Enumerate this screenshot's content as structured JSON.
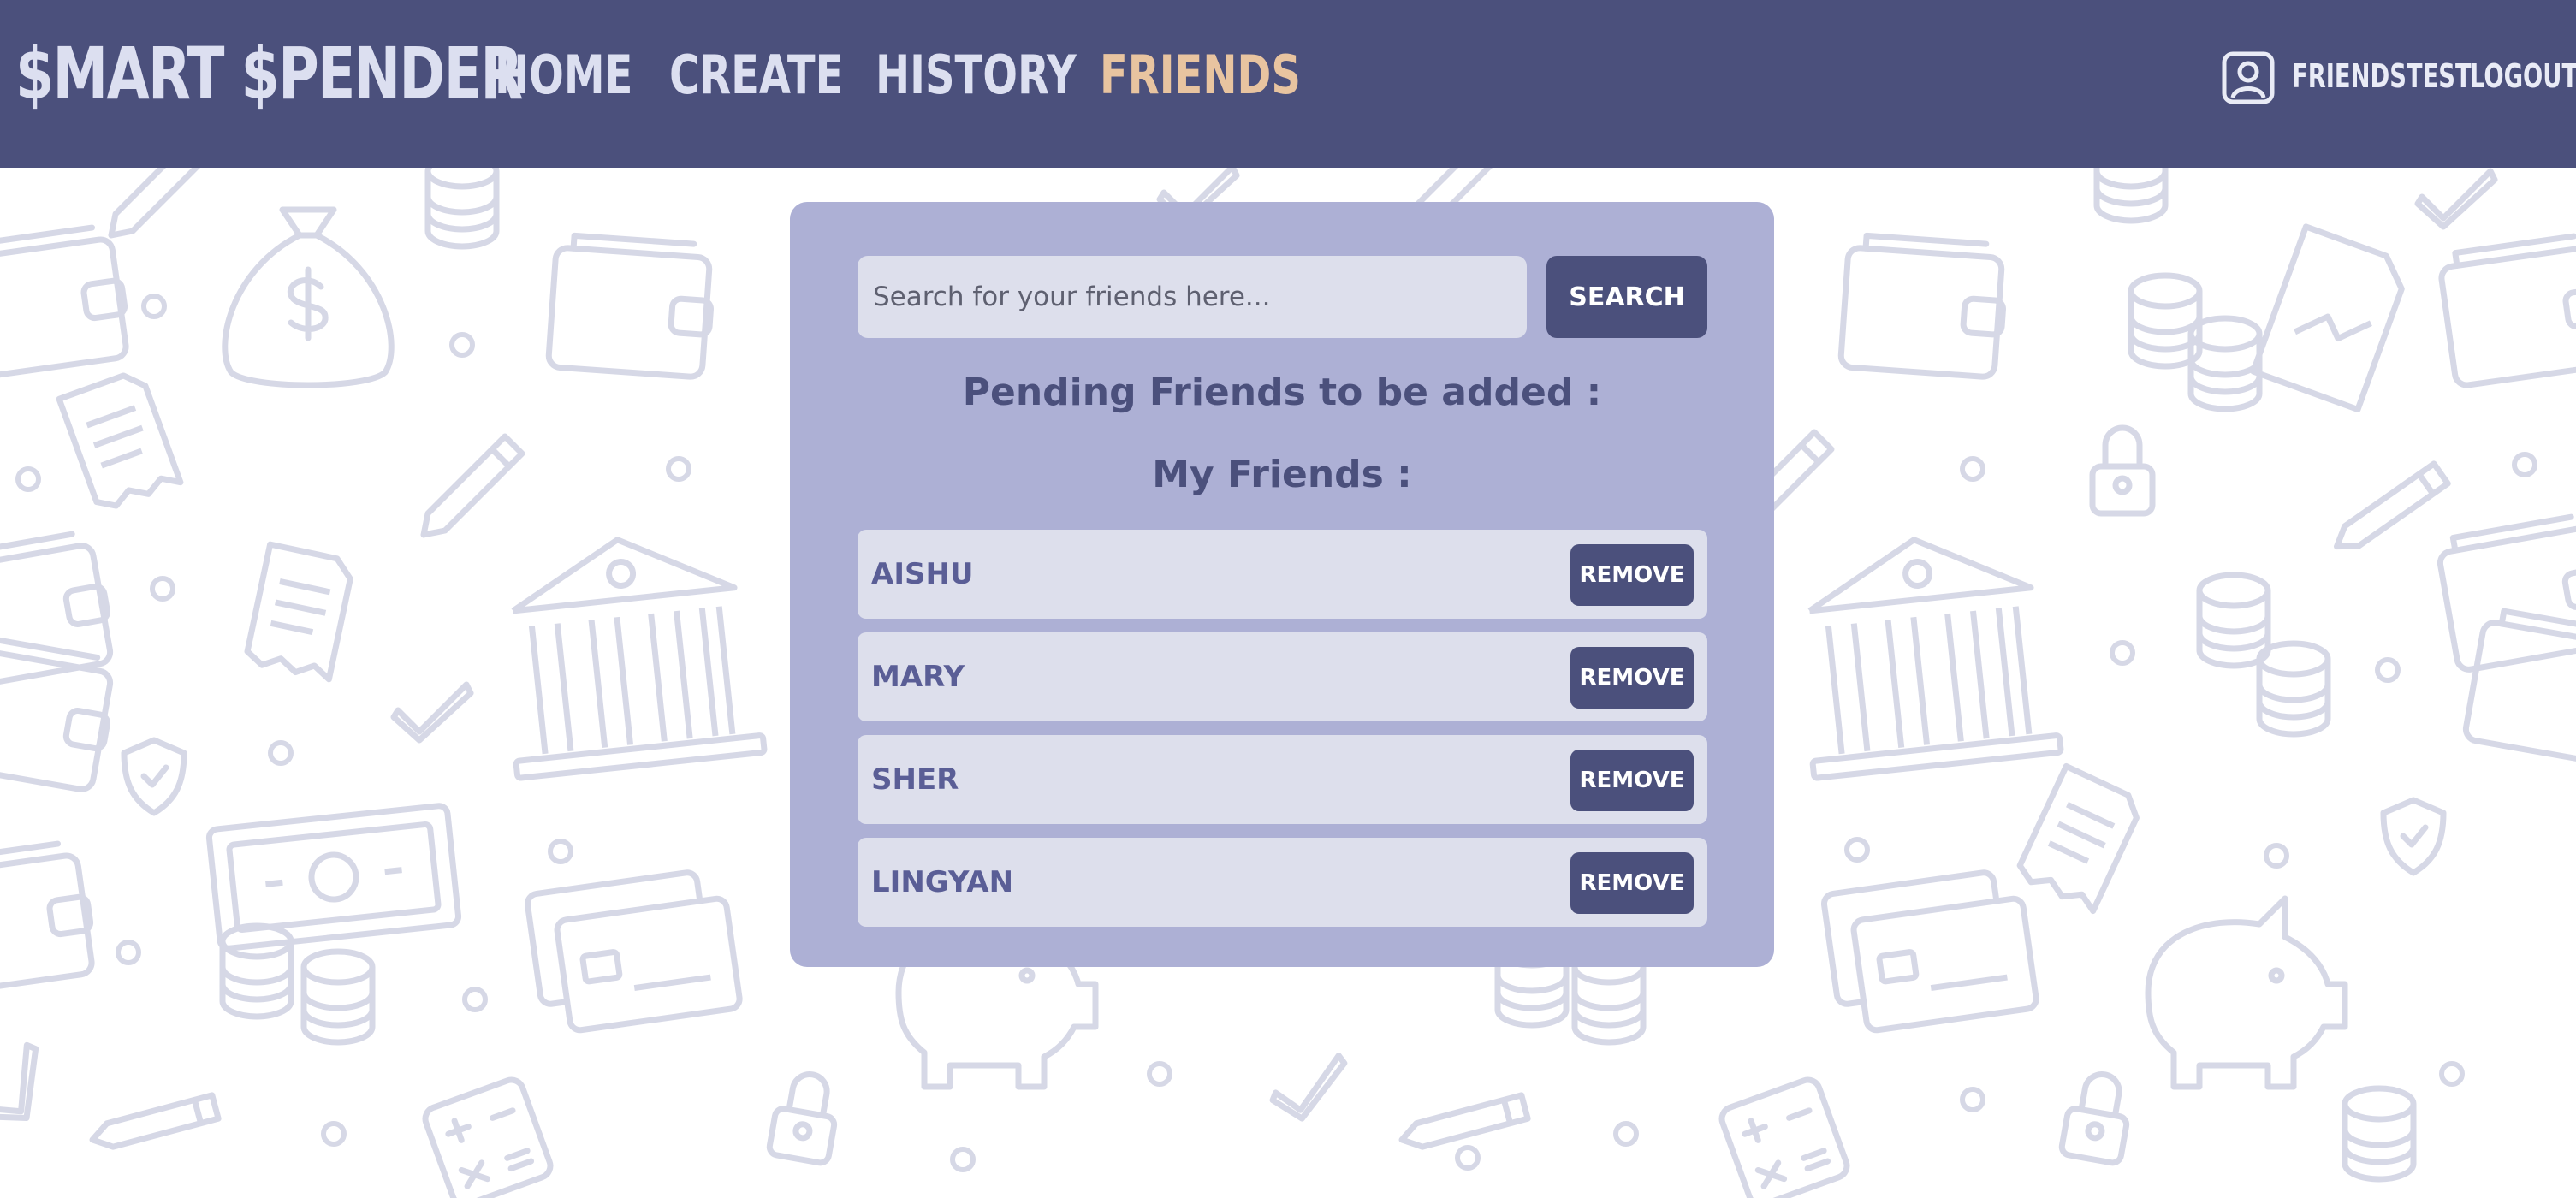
{
  "nav": {
    "brand": "$MART $PENDER",
    "links": [
      {
        "label": "HOME",
        "active": false
      },
      {
        "label": "CREATE",
        "active": false
      },
      {
        "label": "HISTORY",
        "active": false
      },
      {
        "label": "FRIENDS",
        "active": true
      }
    ],
    "user": {
      "username": "FRIENDSTEST",
      "icon": "user-profile-icon"
    },
    "logout_label": "LOGOUT"
  },
  "search": {
    "placeholder": "Search for your friends here...",
    "value": "",
    "button_label": "SEARCH"
  },
  "pending_heading": "Pending Friends to be added :",
  "friends_heading": "My Friends :",
  "friends": [
    {
      "name": "AISHU",
      "action": "REMOVE"
    },
    {
      "name": "MARY",
      "action": "REMOVE"
    },
    {
      "name": "SHER",
      "action": "REMOVE"
    },
    {
      "name": "LINGYAN",
      "action": "REMOVE"
    }
  ],
  "colors": {
    "navbar": "#4b507c",
    "nav_text": "#dcdff0",
    "nav_active": "#e8c4a0",
    "panel": "#adb0d5",
    "row": "#dddfec",
    "button": "#4b507c",
    "friend_name": "#5a5e96",
    "pattern": "#d6d8e6"
  },
  "background_icons": [
    "money-bag-icon",
    "wallet-icon",
    "coins-icon",
    "bank-icon",
    "receipt-icon",
    "pencil-icon",
    "check-icon",
    "shield-icon",
    "banknote-icon",
    "credit-card-icon",
    "piggy-bank-icon",
    "padlock-icon",
    "calculator-icon",
    "chart-document-icon"
  ]
}
